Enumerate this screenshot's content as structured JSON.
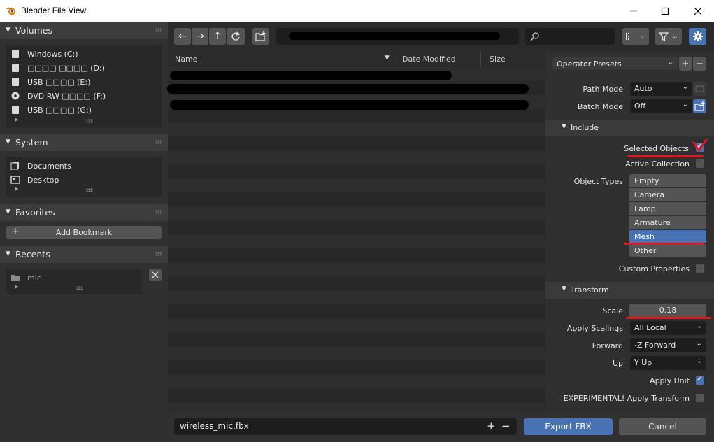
{
  "window": {
    "title": "Blender File View"
  },
  "sidebar": {
    "volumes": {
      "title": "Volumes",
      "items": [
        {
          "label": "Windows (C:)",
          "icon": "drive-icon"
        },
        {
          "label": "□□□□ □□□□ (D:)",
          "icon": "drive-icon"
        },
        {
          "label": "USB □□□□ (E:)",
          "icon": "usb-drive-icon"
        },
        {
          "label": "DVD RW □□□□ (F:)",
          "icon": "disc-icon"
        },
        {
          "label": "USB □□□□ (G:)",
          "icon": "usb-drive-icon"
        }
      ]
    },
    "system": {
      "title": "System",
      "items": [
        {
          "label": "Documents",
          "icon": "documents-icon"
        },
        {
          "label": "Desktop",
          "icon": "desktop-icon"
        }
      ]
    },
    "favorites": {
      "title": "Favorites",
      "add_bookmark": "Add Bookmark"
    },
    "recents": {
      "title": "Recents",
      "items": [
        {
          "label": "mic",
          "icon": "folder-icon"
        }
      ]
    }
  },
  "file_list": {
    "columns": {
      "name": "Name",
      "date": "Date Modified",
      "size": "Size"
    }
  },
  "bottom": {
    "filename": "wireless_mic.fbx",
    "export_label": "Export FBX",
    "cancel_label": "Cancel"
  },
  "props": {
    "operator_presets": "Operator Presets",
    "path_mode": {
      "label": "Path Mode",
      "value": "Auto"
    },
    "batch_mode": {
      "label": "Batch Mode",
      "value": "Off"
    },
    "include": {
      "title": "Include",
      "selected_objects": {
        "label": "Selected Objects",
        "checked": true
      },
      "active_collection": {
        "label": "Active Collection",
        "checked": false
      },
      "object_types_label": "Object Types",
      "object_types": [
        {
          "label": "Empty",
          "selected": false
        },
        {
          "label": "Camera",
          "selected": false
        },
        {
          "label": "Lamp",
          "selected": false
        },
        {
          "label": "Armature",
          "selected": false
        },
        {
          "label": "Mesh",
          "selected": true
        },
        {
          "label": "Other",
          "selected": false
        }
      ],
      "custom_properties": {
        "label": "Custom Properties",
        "checked": false
      }
    },
    "transform": {
      "title": "Transform",
      "scale": {
        "label": "Scale",
        "value": "0.18"
      },
      "apply_scalings": {
        "label": "Apply Scalings",
        "value": "All Local"
      },
      "forward": {
        "label": "Forward",
        "value": "-Z Forward"
      },
      "up": {
        "label": "Up",
        "value": "Y Up"
      },
      "apply_unit": {
        "label": "Apply Unit",
        "checked": true
      },
      "apply_transform": {
        "label": "!EXPERIMENTAL! Apply Transform",
        "checked": false
      }
    }
  },
  "colors": {
    "accent": "#4772b3",
    "annotation": "#e0171e",
    "bg": "#303030"
  }
}
